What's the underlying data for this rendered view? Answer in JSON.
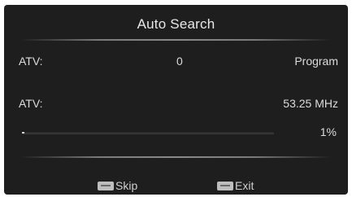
{
  "dialog": {
    "title": "Auto Search"
  },
  "rows": {
    "atv_count": {
      "label": "ATV:",
      "value": "0",
      "right_label": "Program"
    },
    "atv_frequency": {
      "label": "ATV:",
      "value": "53.25 MHz"
    }
  },
  "progress": {
    "fraction": 0.01,
    "label": "1%"
  },
  "footer": {
    "skip": {
      "key_icon": "menu-key-icon",
      "label": "Skip"
    },
    "exit": {
      "key_icon": "exit-key-icon",
      "label": "Exit"
    }
  }
}
